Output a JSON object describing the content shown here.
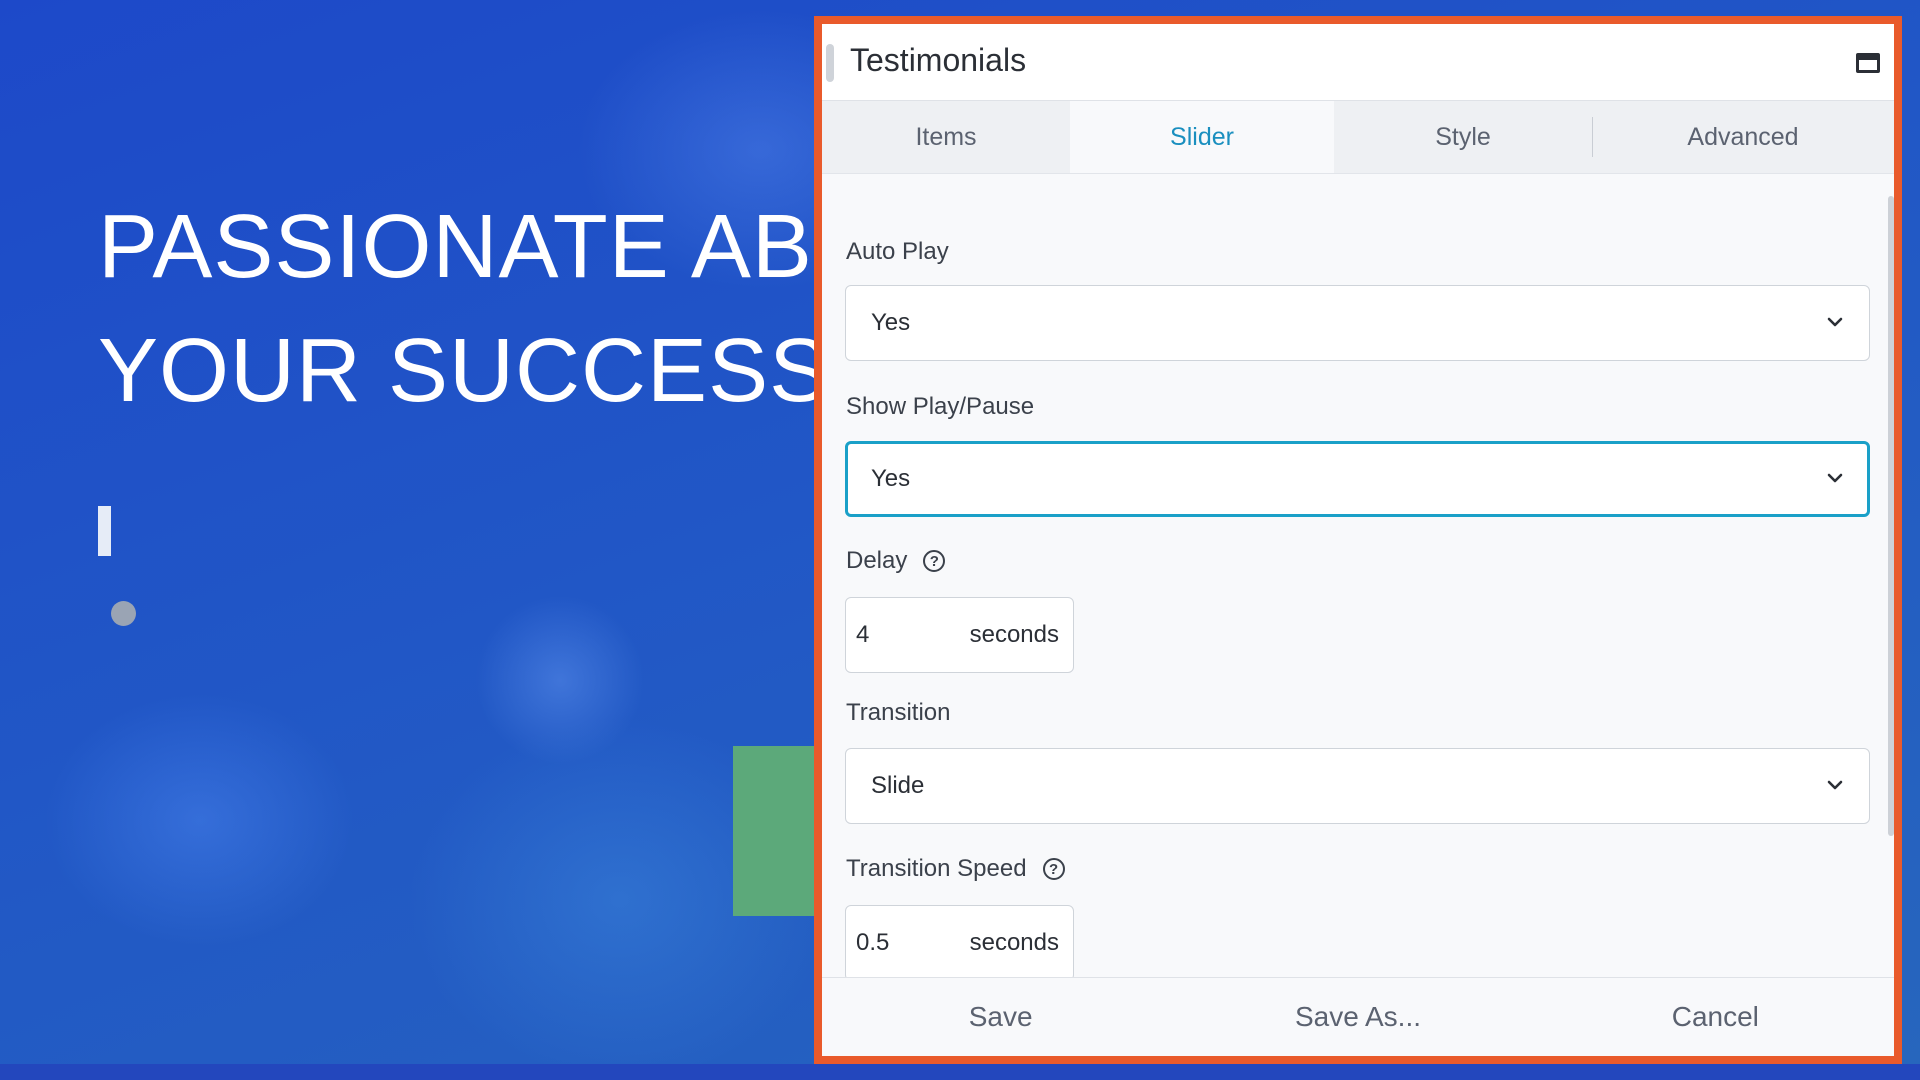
{
  "hero": {
    "line1": "PASSIONATE ABOUT",
    "line2": "YOUR SUCCESS"
  },
  "dialog": {
    "title": "Testimonials",
    "maximize_icon": "maximize-window-icon"
  },
  "tabs": [
    {
      "label": "Items",
      "active": false
    },
    {
      "label": "Slider",
      "active": true
    },
    {
      "label": "Style",
      "active": false
    },
    {
      "label": "Advanced",
      "active": false
    }
  ],
  "fields": {
    "auto_play": {
      "label": "Auto Play",
      "value": "Yes"
    },
    "show_play_pause": {
      "label": "Show Play/Pause",
      "value": "Yes"
    },
    "delay": {
      "label": "Delay",
      "value": "4",
      "unit": "seconds",
      "help": "?"
    },
    "transition": {
      "label": "Transition",
      "value": "Slide"
    },
    "transition_speed": {
      "label": "Transition Speed",
      "value": "0.5",
      "unit": "seconds",
      "help": "?"
    }
  },
  "footer": {
    "save": "Save",
    "save_as": "Save As...",
    "cancel": "Cancel"
  },
  "colors": {
    "accent": "#1a8fbf",
    "dialog_border": "#e95a2b",
    "focus_border": "#1aa0c8",
    "background_blue": "#1d49c9"
  }
}
